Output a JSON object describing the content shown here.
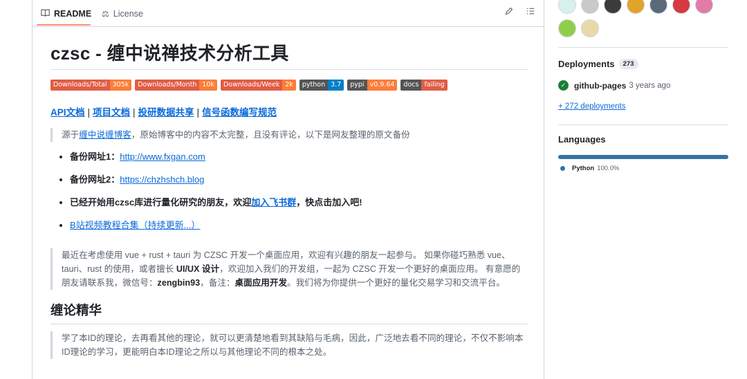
{
  "tabs": {
    "readme": "README",
    "license": "License"
  },
  "readme": {
    "title": "czsc - 缠中说禅技术分析工具",
    "badges": [
      {
        "label": "Downloads/Total",
        "value": "305k",
        "color": "#fe7d37"
      },
      {
        "label": "Downloads/Month",
        "value": "10k",
        "color": "#fe7d37"
      },
      {
        "label": "Downloads/Week",
        "value": "2k",
        "color": "#fe7d37"
      },
      {
        "label": "python",
        "value": "3.7",
        "color": "#007ec6"
      },
      {
        "label": "pypi",
        "value": "v0.9.64",
        "color": "#fe7d37"
      },
      {
        "label": "docs",
        "value": "failing",
        "color": "#e05d44"
      }
    ],
    "links": [
      "API文档",
      "项目文档",
      "投研数据共享",
      "信号函数编写规范"
    ],
    "link_sep": "|",
    "quote1": {
      "prefix": "源于",
      "link": "缠中说缠博客",
      "suffix": "，原始博客中的内容不太完整，且没有评论，以下是网友整理的原文备份"
    },
    "items": [
      {
        "label": "备份网址1：",
        "link": "http://www.fxgan.com",
        "suffix": ""
      },
      {
        "label": "备份网址2：",
        "link": "https://chzhshch.blog",
        "suffix": ""
      },
      {
        "label": "已经开始用czsc库进行量化研究的朋友，欢迎",
        "link": "加入飞书群",
        "suffix": "，快点击加入吧!"
      },
      {
        "label": "",
        "link": "B站视频教程合集（持续更新...）",
        "suffix": ""
      }
    ],
    "quote2": {
      "t1": "最近在考虑使用 vue + rust + tauri 为 CZSC 开发一个桌面应用，欢迎有兴趣的朋友一起参与。 如果你碰巧熟悉 vue、tauri、rust 的使用，或者擅长 ",
      "b1": "UI/UX 设计",
      "t2": "，欢迎加入我们的开发组，一起为 CZSC 开发一个更好的桌面应用。 有意愿的朋友请联系我，微信号：",
      "b2": "zengbin93",
      "t3": "，备注：",
      "b3": "桌面应用开发",
      "t4": "。我们将为你提供一个更好的量化交易学习和交流平台。"
    },
    "section_title": "缠论精华",
    "quote3": "学了本ID的理论，去再看其他的理论，就可以更清楚地看到其缺陷与毛病，因此，广泛地去看不同的理论，不仅不影响本ID理论的学习，更能明白本ID理论之所以与其他理论不同的根本之处。"
  },
  "sidebar": {
    "deployments_title": "Deployments",
    "deployments_count": "273",
    "deploy_name": "github-pages",
    "deploy_time": "3 years ago",
    "more_deployments": "+ 272 deployments",
    "languages_title": "Languages",
    "language_name": "Python",
    "language_pct": "100.0%",
    "language_share": 100.0,
    "language_color": "#3572A5"
  }
}
